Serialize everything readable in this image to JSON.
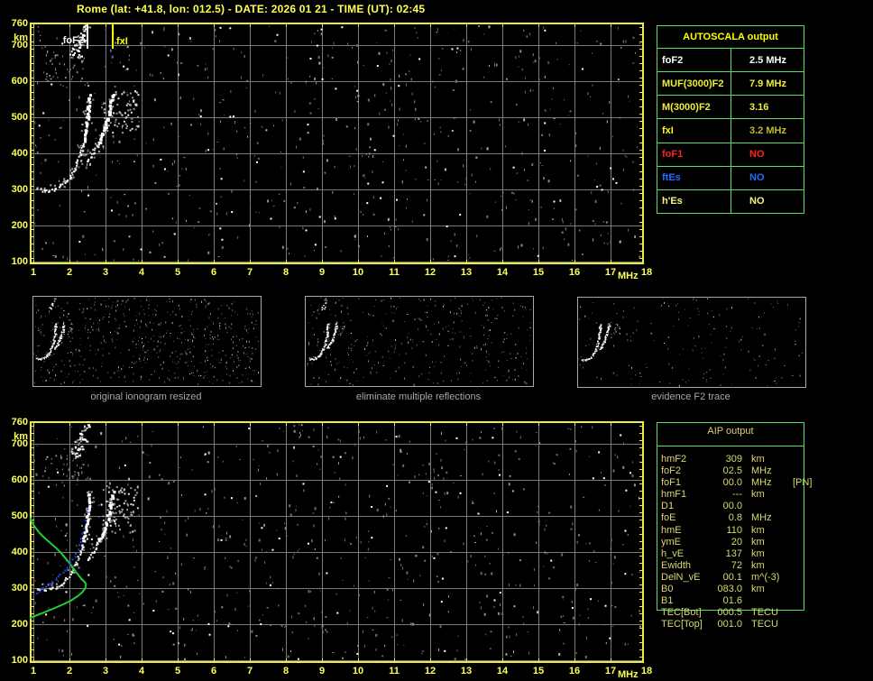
{
  "title": "Rome (lat: +41.8, lon: 012.5) - DATE: 2026 01 21 - TIME (UT): 02:45",
  "colors": {
    "background": "#000000",
    "plot_border": "#EDED3A",
    "grid": "#7A7A7A",
    "axis_label": "#FFFF55",
    "table_border": "#55DD66",
    "aip_text": "#D8D870",
    "thumb_border": "#A8A8A8",
    "caption_text": "#A8A8A8",
    "trace_white": "#FFFFFF",
    "noise_gray": "#909090",
    "profile_green": "#22CC33",
    "restored_blue": "#2743F0",
    "marker_foF2": "#FFFFFF",
    "marker_fxI": "#FFFF00"
  },
  "autoscala_table": {
    "header": "AUTOSCALA output",
    "rows": [
      {
        "label": "foF2",
        "value": "2.5 MHz",
        "label_color": "#FFFFFF",
        "value_color": "#FFFFFF"
      },
      {
        "label": "MUF(3000)F2",
        "value": "7.9 MHz",
        "label_color": "#EDED3A",
        "value_color": "#EDED3A"
      },
      {
        "label": "M(3000)F2",
        "value": "3.16",
        "label_color": "#EDED3A",
        "value_color": "#EDED3A"
      },
      {
        "label": "fxI",
        "value": "3.2 MHz",
        "label_color": "#FFFF00",
        "value_color": "#BDBD2E"
      },
      {
        "label": "foF1",
        "value": "NO",
        "label_color": "#FF2222",
        "value_color": "#FF2222"
      },
      {
        "label": "ftEs",
        "value": "NO",
        "label_color": "#1E6EFF",
        "value_color": "#1E6EFF"
      },
      {
        "label": "h'Es",
        "value": "NO",
        "label_color": "#F5F581",
        "value_color": "#F5F581"
      }
    ]
  },
  "aip_table": {
    "header": "AIP output",
    "rows": [
      {
        "label": "hmF2",
        "value": "309",
        "unit": "km",
        "extra": ""
      },
      {
        "label": "foF2",
        "value": "02.5",
        "unit": "MHz",
        "extra": ""
      },
      {
        "label": "foF1",
        "value": "00.0",
        "unit": "MHz",
        "extra": "[PN]"
      },
      {
        "label": "hmF1",
        "value": "---",
        "unit": "km",
        "extra": ""
      },
      {
        "label": "D1",
        "value": "00.0",
        "unit": "",
        "extra": ""
      },
      {
        "label": "foE",
        "value": "0.8",
        "unit": "MHz",
        "extra": ""
      },
      {
        "label": "hmE",
        "value": "110",
        "unit": "km",
        "extra": ""
      },
      {
        "label": "ymE",
        "value": "20",
        "unit": "km",
        "extra": ""
      },
      {
        "label": "h_vE",
        "value": "137",
        "unit": "km",
        "extra": ""
      },
      {
        "label": "Ewidth",
        "value": "72",
        "unit": "km",
        "extra": ""
      },
      {
        "label": "DelN_vE",
        "value": "00.1",
        "unit": "m^(-3)",
        "extra": ""
      },
      {
        "label": "B0",
        "value": "083.0",
        "unit": "km",
        "extra": ""
      },
      {
        "label": "B1",
        "value": "01.6",
        "unit": "",
        "extra": ""
      },
      {
        "label": "TEC[Bot]",
        "value": "000.5",
        "unit": "TECU",
        "extra": ""
      },
      {
        "label": "TEC[Top]",
        "value": "001.0",
        "unit": "TECU",
        "extra": ""
      }
    ]
  },
  "thumbnails": [
    {
      "caption": "original ionogram resized",
      "noise_dots": 520,
      "white_dots": 45,
      "seed": 101,
      "show_second_hop": true
    },
    {
      "caption": "eliminate multiple reflections",
      "noise_dots": 310,
      "white_dots": 28,
      "seed": 202,
      "show_second_hop": true
    },
    {
      "caption": "evidence F2 trace",
      "noise_dots": 150,
      "white_dots": 16,
      "seed": 303,
      "show_second_hop": false
    }
  ],
  "noise": {
    "main_plot_dots": 640,
    "main_plot_white_dots": 70,
    "seed_top": 7,
    "seed_bottom": 13
  },
  "chart_data": {
    "type": "scatter",
    "title": "",
    "xlabel": "MHz",
    "ylabel": "km",
    "xlim": [
      0.9,
      17.9
    ],
    "ylim": [
      95,
      762
    ],
    "grid": true,
    "x_ticks": [
      1,
      2,
      3,
      4,
      5,
      6,
      7,
      8,
      9,
      10,
      11,
      12,
      13,
      14,
      15,
      16,
      17,
      18
    ],
    "y_ticks": [
      760,
      700,
      600,
      500,
      400,
      300,
      200,
      100
    ],
    "markers": [
      {
        "label": "foF2",
        "freq": 2.5,
        "color": "#FFFFFF",
        "label_side": "left"
      },
      {
        "label": "fxI",
        "freq": 3.2,
        "color": "#FFFF00",
        "label_side": "right"
      }
    ],
    "series": [
      {
        "name": "F2 O-mode echo trace",
        "color": "#FFFFFF",
        "points": [
          [
            1.12,
            301
          ],
          [
            1.3,
            298
          ],
          [
            1.5,
            300
          ],
          [
            1.68,
            307
          ],
          [
            1.85,
            320
          ],
          [
            2.0,
            338
          ],
          [
            2.12,
            358
          ],
          [
            2.22,
            381
          ],
          [
            2.31,
            407
          ],
          [
            2.38,
            434
          ],
          [
            2.44,
            465
          ],
          [
            2.48,
            500
          ],
          [
            2.51,
            538
          ],
          [
            2.52,
            562
          ]
        ]
      },
      {
        "name": "F2 X-mode echo trace",
        "color": "#FFFFFF",
        "points": [
          [
            2.48,
            378
          ],
          [
            2.62,
            398
          ],
          [
            2.76,
            422
          ],
          [
            2.88,
            449
          ],
          [
            2.98,
            477
          ],
          [
            3.07,
            507
          ],
          [
            3.13,
            537
          ],
          [
            3.18,
            566
          ]
        ]
      },
      {
        "name": "diffuse spread echoes",
        "color": "#AAAAAA",
        "points": [
          [
            3.42,
            472
          ],
          [
            3.52,
            492
          ],
          [
            3.62,
            515
          ],
          [
            3.71,
            540
          ],
          [
            3.79,
            565
          ]
        ]
      },
      {
        "name": "second hop echoes",
        "color": "#FFFFFF",
        "points": [
          [
            2.08,
            676
          ],
          [
            2.14,
            688
          ],
          [
            2.2,
            700
          ],
          [
            2.26,
            710
          ],
          [
            2.31,
            722
          ],
          [
            2.36,
            734
          ],
          [
            2.41,
            746
          ],
          [
            2.45,
            756
          ],
          [
            2.18,
            682
          ],
          [
            2.3,
            695
          ],
          [
            2.38,
            715
          ],
          [
            2.22,
            668
          ]
        ]
      },
      {
        "name": "electron density profile",
        "color": "#22CC33",
        "plot": "bottom",
        "points": [
          [
            0.9,
            495
          ],
          [
            1.02,
            472
          ],
          [
            1.15,
            455
          ],
          [
            1.3,
            440
          ],
          [
            1.45,
            427
          ],
          [
            1.62,
            412
          ],
          [
            1.78,
            396
          ],
          [
            1.93,
            378
          ],
          [
            2.07,
            360
          ],
          [
            2.2,
            342
          ],
          [
            2.32,
            327
          ],
          [
            2.42,
            317
          ],
          [
            2.46,
            311
          ],
          [
            2.44,
            300
          ],
          [
            2.36,
            289
          ],
          [
            2.22,
            277
          ],
          [
            2.05,
            266
          ],
          [
            1.85,
            256
          ],
          [
            1.62,
            246
          ],
          [
            1.38,
            236
          ],
          [
            1.15,
            227
          ],
          [
            0.98,
            220
          ],
          [
            0.9,
            216
          ]
        ]
      },
      {
        "name": "restored h'(f) trace",
        "color": "#2743F0",
        "plot": "bottom",
        "points": [
          [
            0.97,
            283
          ],
          [
            1.08,
            290
          ],
          [
            1.2,
            298
          ],
          [
            1.33,
            307
          ],
          [
            1.46,
            316
          ],
          [
            1.6,
            327
          ],
          [
            1.73,
            339
          ],
          [
            1.86,
            352
          ],
          [
            1.97,
            366
          ],
          [
            2.08,
            382
          ],
          [
            2.17,
            400
          ],
          [
            2.25,
            420
          ],
          [
            2.31,
            440
          ],
          [
            2.35,
            452
          ]
        ],
        "sparse_points": [
          [
            2.39,
            468
          ],
          [
            2.42,
            490
          ],
          [
            2.45,
            512
          ],
          [
            2.48,
            521
          ]
        ]
      }
    ]
  }
}
